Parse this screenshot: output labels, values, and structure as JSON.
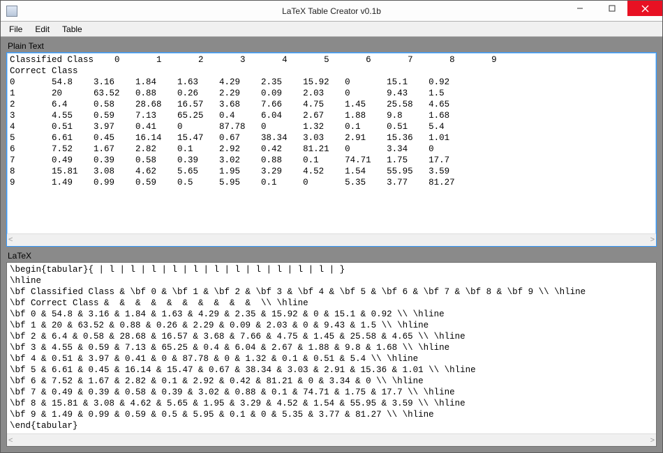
{
  "window": {
    "title": "LaTeX Table Creator v0.1b"
  },
  "menu": {
    "file": "File",
    "edit": "Edit",
    "table": "Table"
  },
  "labels": {
    "plaintext": "Plain Text",
    "latex": "LaTeX"
  },
  "plaintext": {
    "header_label": "Classified Class",
    "subheader_label": "Correct Class",
    "columns": [
      "0",
      "1",
      "2",
      "3",
      "4",
      "5",
      "6",
      "7",
      "8",
      "9"
    ],
    "rows": [
      {
        "label": "0",
        "values": [
          "54.8",
          "3.16",
          "1.84",
          "1.63",
          "4.29",
          "2.35",
          "15.92",
          "0",
          "15.1",
          "0.92"
        ]
      },
      {
        "label": "1",
        "values": [
          "20",
          "63.52",
          "0.88",
          "0.26",
          "2.29",
          "0.09",
          "2.03",
          "0",
          "9.43",
          "1.5"
        ]
      },
      {
        "label": "2",
        "values": [
          "6.4",
          "0.58",
          "28.68",
          "16.57",
          "3.68",
          "7.66",
          "4.75",
          "1.45",
          "25.58",
          "4.65"
        ]
      },
      {
        "label": "3",
        "values": [
          "4.55",
          "0.59",
          "7.13",
          "65.25",
          "0.4",
          "6.04",
          "2.67",
          "1.88",
          "9.8",
          "1.68"
        ]
      },
      {
        "label": "4",
        "values": [
          "0.51",
          "3.97",
          "0.41",
          "0",
          "87.78",
          "0",
          "1.32",
          "0.1",
          "0.51",
          "5.4"
        ]
      },
      {
        "label": "5",
        "values": [
          "6.61",
          "0.45",
          "16.14",
          "15.47",
          "0.67",
          "38.34",
          "3.03",
          "2.91",
          "15.36",
          "1.01"
        ]
      },
      {
        "label": "6",
        "values": [
          "7.52",
          "1.67",
          "2.82",
          "0.1",
          "2.92",
          "0.42",
          "81.21",
          "0",
          "3.34",
          "0"
        ]
      },
      {
        "label": "7",
        "values": [
          "0.49",
          "0.39",
          "0.58",
          "0.39",
          "3.02",
          "0.88",
          "0.1",
          "74.71",
          "1.75",
          "17.7"
        ]
      },
      {
        "label": "8",
        "values": [
          "15.81",
          "3.08",
          "4.62",
          "5.65",
          "1.95",
          "3.29",
          "4.52",
          "1.54",
          "55.95",
          "3.59"
        ]
      },
      {
        "label": "9",
        "values": [
          "1.49",
          "0.99",
          "0.59",
          "0.5",
          "5.95",
          "0.1",
          "0",
          "5.35",
          "3.77",
          "81.27"
        ]
      }
    ]
  },
  "latex": {
    "begin": "\\begin{tabular}{ | l | l | l | l | l | l | l | l | l | l | l | }",
    "hline": "\\hline",
    "header_row": "\\bf Classified Class & \\bf 0 & \\bf 1 & \\bf 2 & \\bf 3 & \\bf 4 & \\bf 5 & \\bf 6 & \\bf 7 & \\bf 8 & \\bf 9 \\\\ \\hline",
    "subheader_row": "\\bf Correct Class &  &  &  &  &  &  &  &  &  &  \\\\ \\hline",
    "data_rows": [
      "\\bf 0 & 54.8 & 3.16 & 1.84 & 1.63 & 4.29 & 2.35 & 15.92 & 0 & 15.1 & 0.92 \\\\ \\hline",
      "\\bf 1 & 20 & 63.52 & 0.88 & 0.26 & 2.29 & 0.09 & 2.03 & 0 & 9.43 & 1.5 \\\\ \\hline",
      "\\bf 2 & 6.4 & 0.58 & 28.68 & 16.57 & 3.68 & 7.66 & 4.75 & 1.45 & 25.58 & 4.65 \\\\ \\hline",
      "\\bf 3 & 4.55 & 0.59 & 7.13 & 65.25 & 0.4 & 6.04 & 2.67 & 1.88 & 9.8 & 1.68 \\\\ \\hline",
      "\\bf 4 & 0.51 & 3.97 & 0.41 & 0 & 87.78 & 0 & 1.32 & 0.1 & 0.51 & 5.4 \\\\ \\hline",
      "\\bf 5 & 6.61 & 0.45 & 16.14 & 15.47 & 0.67 & 38.34 & 3.03 & 2.91 & 15.36 & 1.01 \\\\ \\hline",
      "\\bf 6 & 7.52 & 1.67 & 2.82 & 0.1 & 2.92 & 0.42 & 81.21 & 0 & 3.34 & 0 \\\\ \\hline",
      "\\bf 7 & 0.49 & 0.39 & 0.58 & 0.39 & 3.02 & 0.88 & 0.1 & 74.71 & 1.75 & 17.7 \\\\ \\hline",
      "\\bf 8 & 15.81 & 3.08 & 4.62 & 5.65 & 1.95 & 3.29 & 4.52 & 1.54 & 55.95 & 3.59 \\\\ \\hline",
      "\\bf 9 & 1.49 & 0.99 & 0.59 & 0.5 & 5.95 & 0.1 & 0 & 5.35 & 3.77 & 81.27 \\\\ \\hline"
    ],
    "end": "\\end{tabular}"
  },
  "scroll": {
    "left_glyph": "<",
    "right_glyph": ">"
  }
}
